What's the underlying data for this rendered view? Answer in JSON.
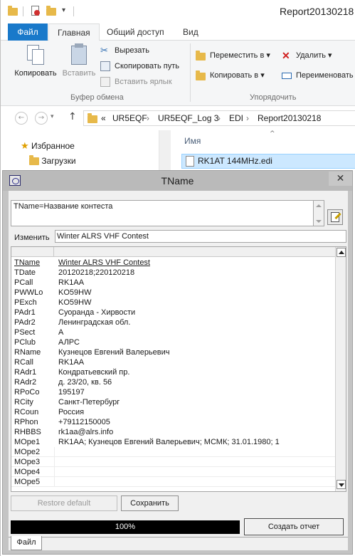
{
  "explorer": {
    "title": "Report20130218",
    "ribbon_tabs": [
      "Файл",
      "Главная",
      "Общий доступ",
      "Вид"
    ],
    "clipboard": {
      "copy": "Копировать",
      "paste": "Вставить",
      "cut": "Вырезать",
      "copy_path": "Скопировать путь",
      "paste_shortcut": "Вставить ярлык",
      "group": "Буфер обмена"
    },
    "organize": {
      "move_to": "Переместить в",
      "copy_to": "Копировать в",
      "delete": "Удалить",
      "rename": "Переименовать",
      "group": "Упорядочить"
    },
    "address": {
      "prefix": "«",
      "crumbs": [
        "UR5EQF",
        "UR5EQF_Log 3",
        "EDI",
        "Report20130218"
      ]
    },
    "nav": {
      "favorites": "Избранное",
      "downloads": "Загрузки"
    },
    "files": {
      "column_name": "Имя",
      "selected_file": "RK1AT 144MHz.edi"
    }
  },
  "dialog": {
    "title": "TName",
    "close_glyph": "✕",
    "description": "TName=Название контеста",
    "change_label": "Изменить",
    "change_value": "Winter ALRS VHF Contest",
    "rows": [
      {
        "key": "TName",
        "value": "Winter ALRS VHF Contest"
      },
      {
        "key": "TDate",
        "value": "20120218;220120218"
      },
      {
        "key": "PCall",
        "value": "RK1AA"
      },
      {
        "key": "PWWLo",
        "value": "KO59HW"
      },
      {
        "key": "PExch",
        "value": "KO59HW"
      },
      {
        "key": "PAdr1",
        "value": "Суоранда - Хирвости"
      },
      {
        "key": "PAdr2",
        "value": "Ленинградская обл."
      },
      {
        "key": "PSect",
        "value": "A"
      },
      {
        "key": "PClub",
        "value": "АЛРС"
      },
      {
        "key": "RName",
        "value": "Кузнецов Евгений Валерьевич"
      },
      {
        "key": "RCall",
        "value": "RK1AA"
      },
      {
        "key": "RAdr1",
        "value": "Кондратьевский пр."
      },
      {
        "key": "RAdr2",
        "value": "д. 23/20, кв. 56"
      },
      {
        "key": "RPoCo",
        "value": "195197"
      },
      {
        "key": "RCity",
        "value": "Санкт-Петербург"
      },
      {
        "key": "RCoun",
        "value": "Россия"
      },
      {
        "key": "RPhon",
        "value": "+79112150005"
      },
      {
        "key": "RHBBS",
        "value": "rk1aa@alrs.info"
      },
      {
        "key": "MOpe1",
        "value": "RK1AA; Кузнецов Евгений Валерьевич; МСМК; 31.01.1980; 1"
      },
      {
        "key": "MOpe2",
        "value": ""
      },
      {
        "key": "MOpe3",
        "value": ""
      },
      {
        "key": "MOpe4",
        "value": ""
      },
      {
        "key": "MOpe5",
        "value": ""
      }
    ],
    "restore_default": "Restore default",
    "save": "Сохранить",
    "progress_text": "100%",
    "progress_value": 100,
    "create_report": "Создать отчет",
    "tab_file": "Файл"
  }
}
